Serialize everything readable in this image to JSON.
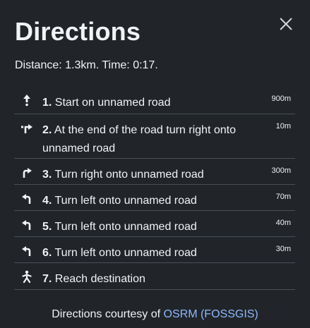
{
  "panel": {
    "title": "Directions",
    "close_icon": "close-icon",
    "summary": {
      "distance_label": "Distance:",
      "distance_value": "1.3km.",
      "time_label": "Time:",
      "time_value": "0:17."
    }
  },
  "steps": [
    {
      "number": "1.",
      "instruction": "Start on unnamed road",
      "distance": "900m",
      "icon": "straight-arrow-icon"
    },
    {
      "number": "2.",
      "instruction": "At the end of the road turn right onto unnamed road",
      "distance": "10m",
      "icon": "end-of-road-right-icon"
    },
    {
      "number": "3.",
      "instruction": "Turn right onto unnamed road",
      "distance": "300m",
      "icon": "turn-right-icon"
    },
    {
      "number": "4.",
      "instruction": "Turn left onto unnamed road",
      "distance": "70m",
      "icon": "turn-left-icon"
    },
    {
      "number": "5.",
      "instruction": "Turn left onto unnamed road",
      "distance": "40m",
      "icon": "turn-left-icon"
    },
    {
      "number": "6.",
      "instruction": "Turn left onto unnamed road",
      "distance": "30m",
      "icon": "turn-left-icon"
    },
    {
      "number": "7.",
      "instruction": "Reach destination",
      "distance": "",
      "icon": "destination-icon"
    }
  ],
  "footer": {
    "prefix": "Directions courtesy of",
    "link_label": "OSRM (FOSSGIS)"
  },
  "colors": {
    "background": "#212529",
    "text": "#f1f3f5",
    "link": "#8fb8ff",
    "divider": "#4a5056"
  }
}
